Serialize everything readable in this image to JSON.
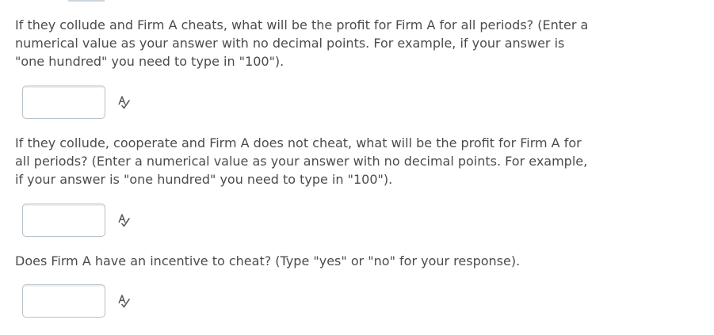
{
  "questions": [
    {
      "text": "If they collude and Firm A cheats, what will be the profit for Firm A for all periods? (Enter a numerical value as your answer with no decimal points. For example, if your answer is \"one hundred\" you need to type in \"100\").",
      "answer_value": ""
    },
    {
      "text": "If they collude, cooperate and Firm A does not cheat, what will be the profit for Firm A for all periods? (Enter a numerical value as your answer with no decimal points. For example, if your answer is \"one hundred\" you need to type in \"100\").",
      "answer_value": ""
    },
    {
      "text": "Does Firm A have an incentive to cheat? (Type \"yes\" or \"no\" for your response).",
      "answer_value": ""
    }
  ],
  "icons": {
    "spellcheck": "spellcheck-icon"
  },
  "colors": {
    "text": "#494c4e",
    "input_border": "#b8c1c8"
  }
}
